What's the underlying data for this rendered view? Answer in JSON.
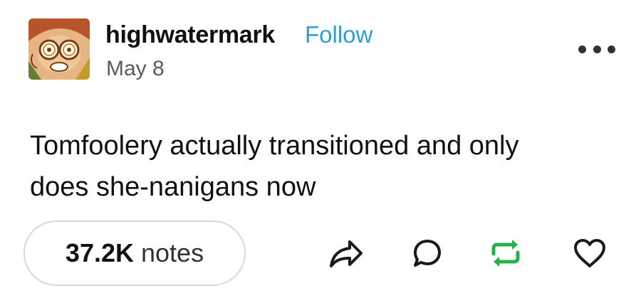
{
  "post": {
    "author": "highwatermark",
    "follow_label": "Follow",
    "date": "May 8",
    "body_line1": "Tomfoolery actually transitioned and only",
    "body_line2": "does she-nanigans now",
    "notes_count": "37.2K",
    "notes_label": "notes"
  },
  "icons": {
    "more": "more-options-icon",
    "share": "share-icon",
    "reply": "reply-icon",
    "reblog": "reblog-icon",
    "like": "heart-icon"
  },
  "colors": {
    "follow": "#2a9fd8",
    "reblog": "#24b34b",
    "text": "#111111",
    "muted": "#5b5b5b"
  }
}
